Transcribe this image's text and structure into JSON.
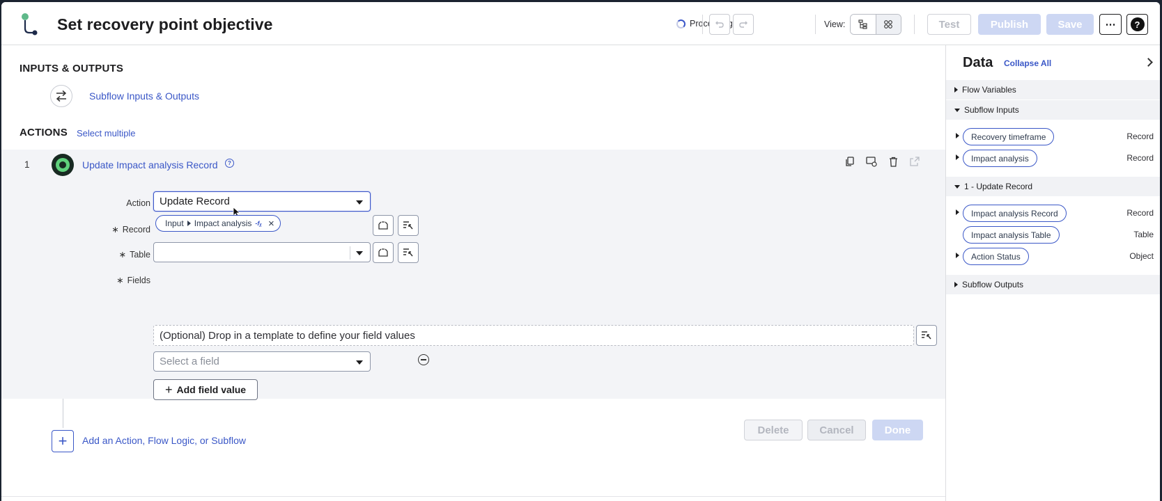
{
  "header": {
    "title": "Set recovery point objective",
    "status": "Processing",
    "view_label": "View:",
    "test_label": "Test",
    "publish_label": "Publish",
    "save_label": "Save",
    "more_label": "⋯",
    "help_label": "?"
  },
  "main": {
    "io_title": "INPUTS & OUTPUTS",
    "io_link": "Subflow Inputs & Outputs",
    "actions_title": "ACTIONS",
    "select_multiple": "Select multiple",
    "step": {
      "number": "1",
      "title": "Update Impact analysis Record",
      "info": "?",
      "action_label": "Action",
      "action_value": "Update Record",
      "record_label": "Record",
      "record_pill_source": "Input",
      "record_pill_value": "Impact analysis",
      "record_pill_fx": "-fᵪ",
      "table_label": "Table",
      "table_value": "",
      "fields_label": "Fields",
      "fields_template_text": "(Optional) Drop in a template to define your field values",
      "select_field_placeholder": "Select a field",
      "add_field_label": "Add field value",
      "delete_label": "Delete",
      "cancel_label": "Cancel",
      "done_label": "Done"
    },
    "add_action_label": "Add an Action, Flow Logic, or Subflow"
  },
  "data_panel": {
    "title": "Data",
    "collapse_all": "Collapse All",
    "groups": {
      "flow_variables": "Flow Variables",
      "subflow_inputs": "Subflow Inputs",
      "update_record": "1 - Update Record",
      "subflow_outputs": "Subflow Outputs"
    },
    "subflow_inputs": [
      {
        "name": "Recovery timeframe",
        "type": "Record"
      },
      {
        "name": "Impact analysis",
        "type": "Record"
      }
    ],
    "update_record_items": [
      {
        "name": "Impact analysis Record",
        "type": "Record"
      },
      {
        "name": "Impact analysis Table",
        "type": "Table"
      },
      {
        "name": "Action Status",
        "type": "Object"
      }
    ]
  },
  "colors": {
    "accent": "#3a57c7",
    "disabled_primary": "#cdd7f3",
    "status_green": "#5fd17c"
  }
}
